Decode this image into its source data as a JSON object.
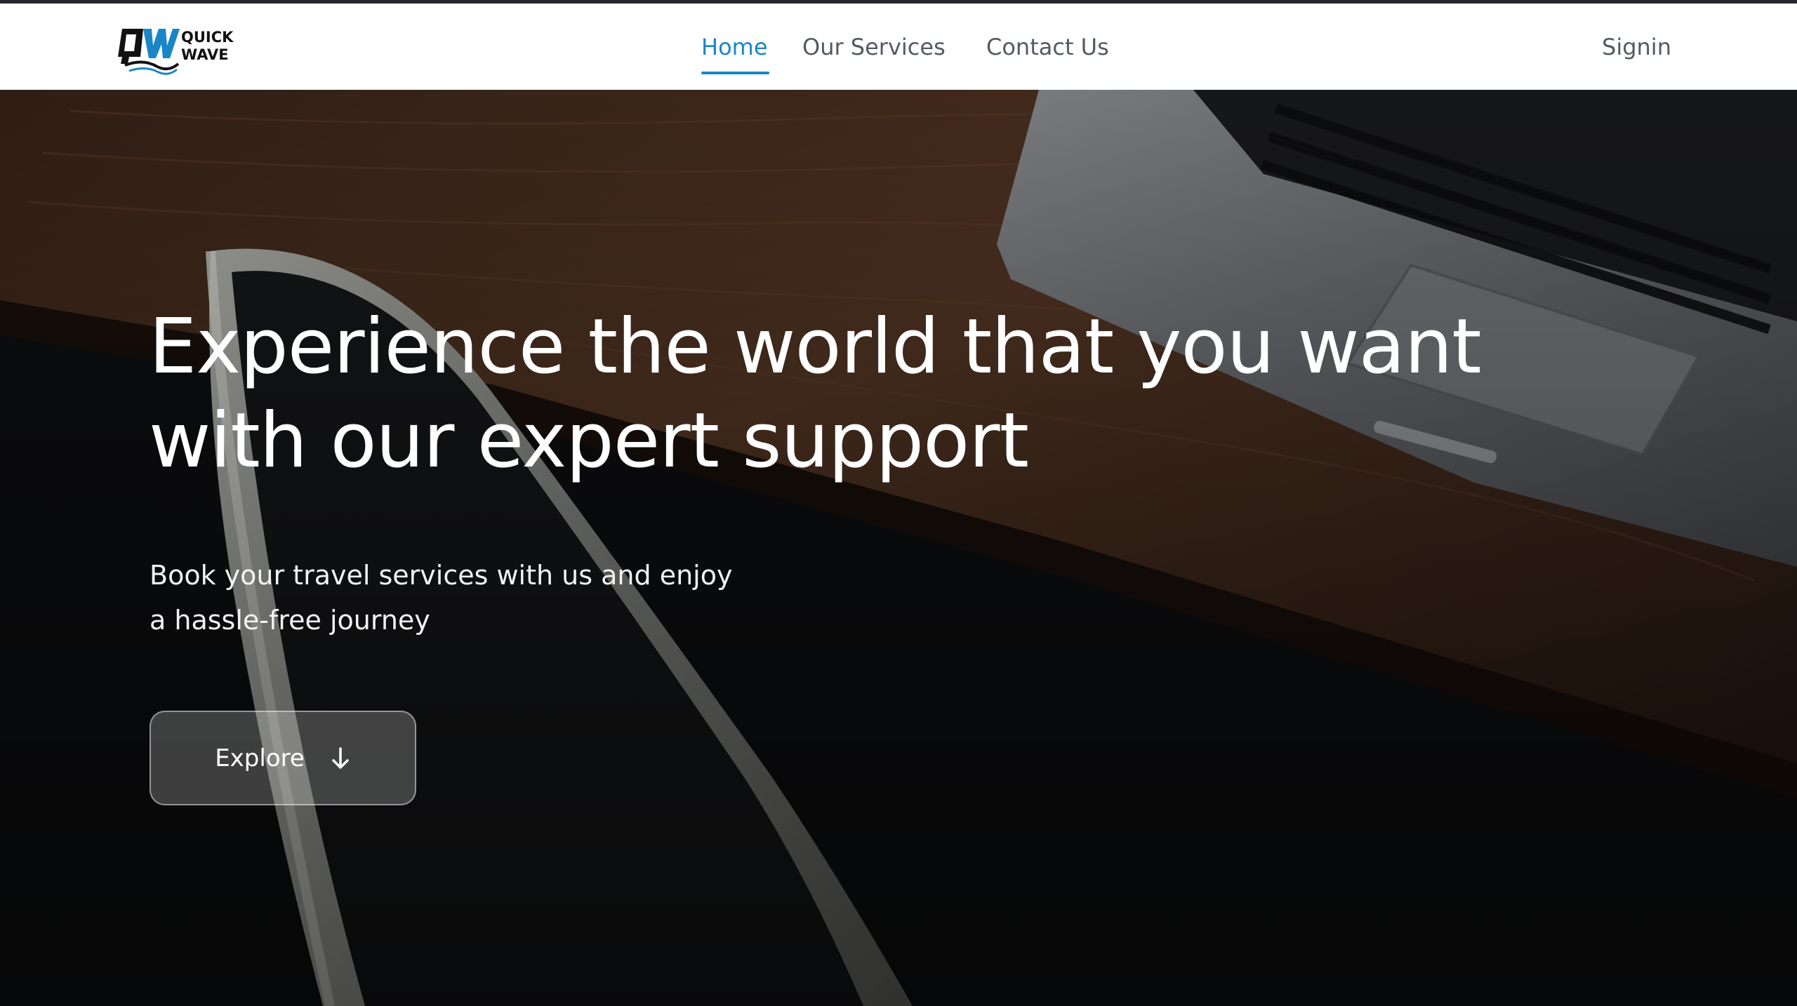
{
  "brand": {
    "logo_letters": "QW",
    "name_line1": "QUICK",
    "name_line2": "WAVE",
    "color_primary": "#1a86c8",
    "color_dark": "#111111"
  },
  "nav": {
    "items": [
      {
        "label": "Home",
        "active": true
      },
      {
        "label": "Our Services",
        "active": false
      },
      {
        "label": "Contact Us",
        "active": false
      }
    ],
    "signin_label": "Signin",
    "active_color": "#1a86c8",
    "text_color": "#555a60"
  },
  "hero": {
    "title_line1": "Experience the world that you want",
    "title_line2": "with our expert support",
    "subtitle_line1": "Book your travel services with us and enjoy",
    "subtitle_line2": "a hassle-free journey",
    "cta_label": "Explore",
    "cta_icon": "arrow-down-icon"
  }
}
